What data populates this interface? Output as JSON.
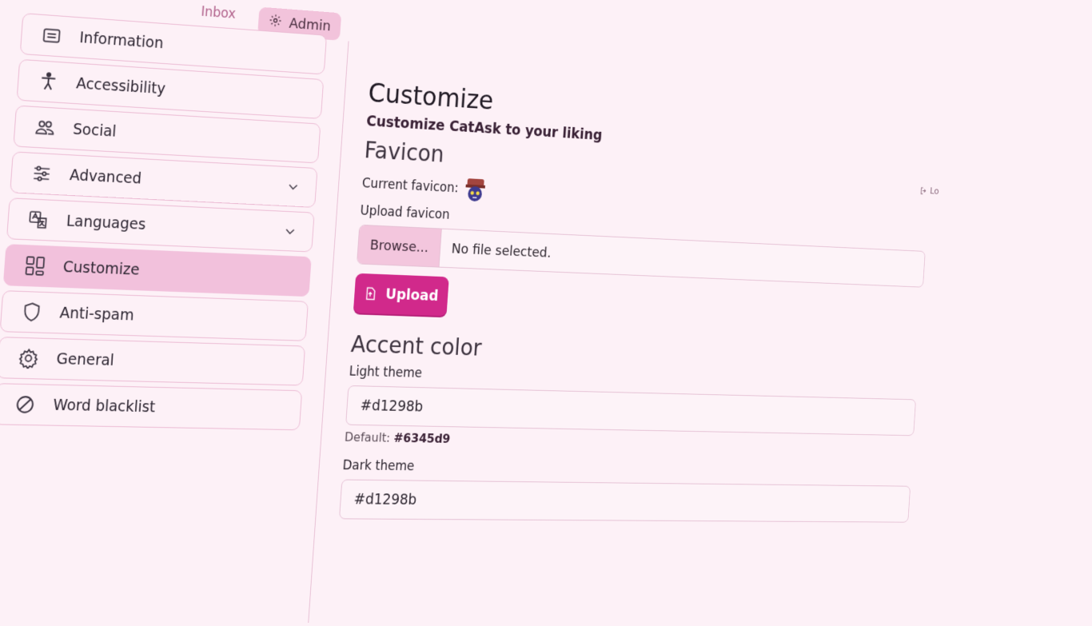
{
  "topnav": {
    "inbox_label": "Inbox",
    "admin_label": "Admin"
  },
  "sidebar": {
    "items": [
      {
        "label": "Information",
        "icon": "list-icon"
      },
      {
        "label": "Accessibility",
        "icon": "accessibility-icon"
      },
      {
        "label": "Social",
        "icon": "people-icon"
      },
      {
        "label": "Advanced",
        "icon": "sliders-icon",
        "expandable": true
      },
      {
        "label": "Languages",
        "icon": "translate-icon",
        "expandable": true
      },
      {
        "label": "Customize",
        "icon": "grid-icon",
        "active": true
      },
      {
        "label": "Anti-spam",
        "icon": "shield-icon"
      },
      {
        "label": "General",
        "icon": "gear-icon"
      },
      {
        "label": "Word blacklist",
        "icon": "slash-circle-icon"
      }
    ]
  },
  "main": {
    "title": "Customize",
    "subtitle": "Customize CatAsk to your liking",
    "logout_label": "Lo",
    "favicon": {
      "section_title": "Favicon",
      "current_label": "Current favicon:",
      "upload_label": "Upload favicon",
      "browse_label": "Browse...",
      "file_status": "No file selected.",
      "upload_button": "Upload"
    },
    "accent": {
      "section_title": "Accent color",
      "light_label": "Light theme",
      "light_value": "#d1298b",
      "light_default_prefix": "Default:",
      "light_default_value": "#6345d9",
      "dark_label": "Dark theme",
      "dark_value": "#d1298b"
    }
  },
  "colors": {
    "accent": "#d1298b",
    "background": "#fdf1f7",
    "active_nav": "#f2c1dc"
  }
}
